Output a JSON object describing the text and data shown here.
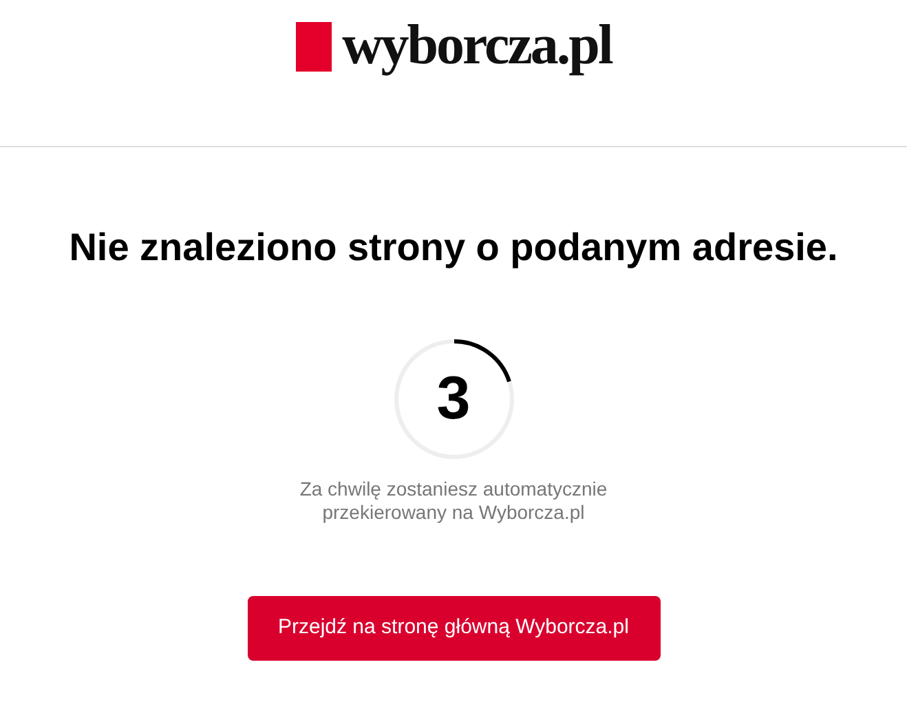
{
  "header": {
    "logo": "wyborcza.pl"
  },
  "heading": "Nie znaleziono strony o podanym adresie.",
  "countdown": {
    "number": "3",
    "level": 0.2
  },
  "message": [
    "Za chwilę zostaniesz automatycznie",
    "przekierowany na Wyborcza.pl"
  ],
  "button": "Przejdź na stronę główną Wyborcza.pl"
}
